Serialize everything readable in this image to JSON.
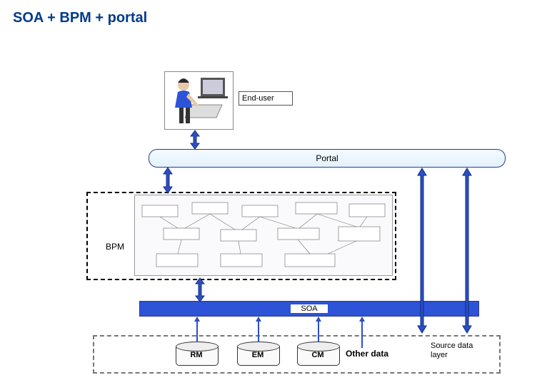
{
  "title": "SOA + BPM + portal",
  "nodes": {
    "end_user": "End-user",
    "portal": "Portal",
    "bpm": "BPM",
    "soa": "SOA",
    "source_layer_label": "Source data\nlayer"
  },
  "databases": {
    "rm": "RM",
    "em": "EM",
    "cm": "CM",
    "other": "Other data"
  },
  "arrows": [
    {
      "id": "user-portal",
      "dir": "both"
    },
    {
      "id": "portal-bpm",
      "dir": "both"
    },
    {
      "id": "bpm-soa",
      "dir": "both"
    },
    {
      "id": "portal-right1",
      "dir": "both"
    },
    {
      "id": "portal-right2",
      "dir": "both"
    },
    {
      "id": "soa-rm",
      "dir": "up"
    },
    {
      "id": "soa-em",
      "dir": "up"
    },
    {
      "id": "soa-cm",
      "dir": "up"
    },
    {
      "id": "soa-other",
      "dir": "up"
    }
  ],
  "colors": {
    "title": "#003a8c",
    "soa_fill": "#2d53d6",
    "portal_fill": "#e8f5fd",
    "arrow_blue": "#2b4fc4",
    "arrow_dark": "#0c2a86"
  }
}
